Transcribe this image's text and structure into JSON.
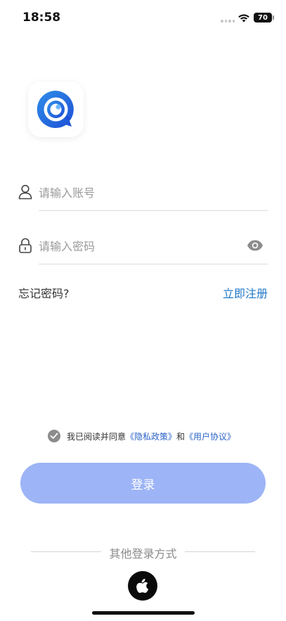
{
  "status": {
    "time": "18:58",
    "battery": "70"
  },
  "colors": {
    "accent": "#1f78c8",
    "policy_link": "#2b63c6",
    "login_button": "#9db4f6"
  },
  "login": {
    "username_placeholder": "请输入账号",
    "password_placeholder": "请输入密码",
    "forgot": "忘记密码?",
    "register": "立即注册",
    "agree_prefix": "我已阅读并同意",
    "privacy_policy": "《隐私政策》",
    "agree_and": "和",
    "user_agreement": "《用户协议》",
    "submit": "登录",
    "other_methods": "其他登录方式"
  },
  "icons": {
    "logo": "chat-bubble-logo-icon",
    "username": "user-icon",
    "password": "lock-icon",
    "toggle_password": "eye-icon",
    "apple": "apple-icon"
  }
}
